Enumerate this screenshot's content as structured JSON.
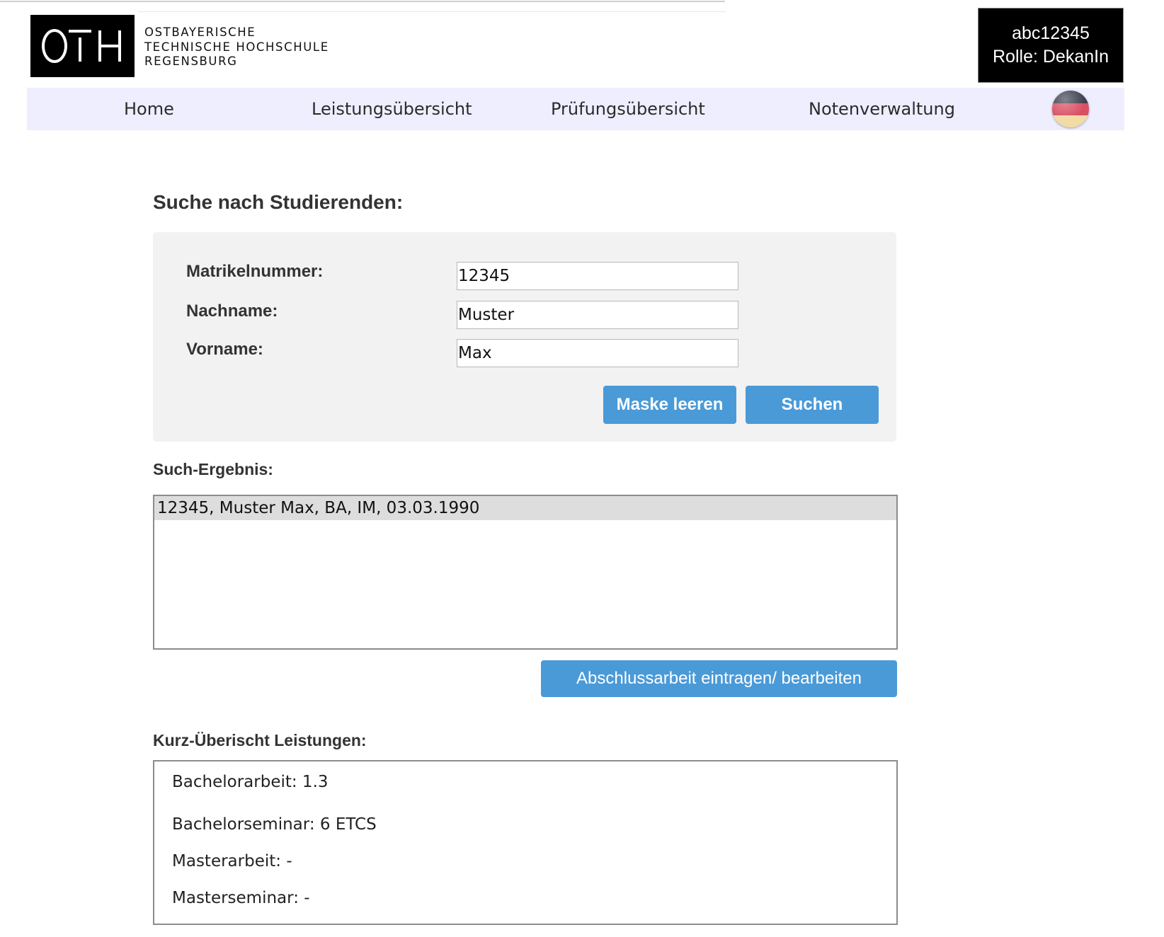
{
  "header": {
    "logo": {
      "mark": "OTH",
      "lines": [
        "OSTBAYERISCHE",
        "TECHNISCHE HOCHSCHULE",
        "REGENSBURG"
      ]
    },
    "user": {
      "id": "abc12345",
      "role": "Rolle: DekanIn"
    }
  },
  "nav": {
    "items": [
      {
        "label": "Home"
      },
      {
        "label": "Leistungsübersicht"
      },
      {
        "label": "Prüfungsübersicht"
      },
      {
        "label": "Notenverwaltung"
      }
    ],
    "language_icon": "german-flag-icon"
  },
  "search": {
    "title": "Suche nach Studierenden:",
    "fields": [
      {
        "label": "Matrikelnummer:",
        "value": "12345"
      },
      {
        "label": "Nachname:",
        "value": "Muster"
      },
      {
        "label": "Vorname:",
        "value": "Max"
      }
    ],
    "clear_label": "Maske leeren",
    "submit_label": "Suchen"
  },
  "results": {
    "title": "Such-Ergebnis:",
    "rows": [
      "12345, Muster Max, BA, IM, 03.03.1990"
    ],
    "action_label": "Abschlussarbeit eintragen/ bearbeiten"
  },
  "summary": {
    "title": "Kurz-Überischt Leistungen:",
    "lines": [
      "Bachelorarbeit: 1.3",
      "Bachelorseminar: 6 ETCS",
      "Masterarbeit: -",
      "Masterseminar: -"
    ]
  },
  "colors": {
    "primary_button": "#4a9ad8",
    "nav_background": "#eeeeff",
    "panel_background": "#f2f2f2",
    "selected_row": "#dddddd"
  }
}
